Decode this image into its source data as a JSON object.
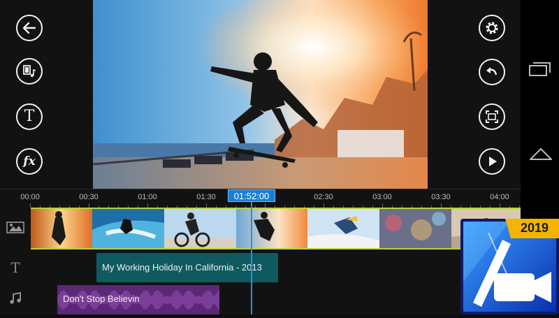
{
  "left_toolbar": {
    "back_icon": "arrow-left-icon",
    "media_icon": "media-library-icon",
    "title_icon": "title-text-icon",
    "fx_icon": "fx-icon",
    "fx_label": "fx",
    "title_label": "T"
  },
  "right_toolbar": {
    "settings_icon": "gear-icon",
    "undo_icon": "undo-icon",
    "fit_icon": "crop-frame-icon",
    "play_icon": "play-icon"
  },
  "timeline": {
    "ruler": [
      "00:00",
      "00:30",
      "01:00",
      "01:30",
      "02:00",
      "02:30",
      "03:00",
      "03:30",
      "04:00"
    ],
    "playhead_time": "01:52:00",
    "text_track_label": "T",
    "title_clip": "My Working Holiday In California - 2013",
    "audio_clip": "Don't Stop Believin",
    "video_track_icon": "video-clip-icon",
    "audio_track_icon": "music-note-icon"
  },
  "system_nav": {
    "recents_icon": "recent-apps-icon",
    "home_icon": "home-icon"
  },
  "logo": {
    "year": "2019",
    "icon": "powerdirector-logo-icon"
  },
  "colors": {
    "accent_blue": "#1a7fd4",
    "video_track_border": "#b6d23a",
    "title_clip": "#0f5a60",
    "audio_clip": "#5b2876",
    "logo_badge": "#f4b400"
  }
}
